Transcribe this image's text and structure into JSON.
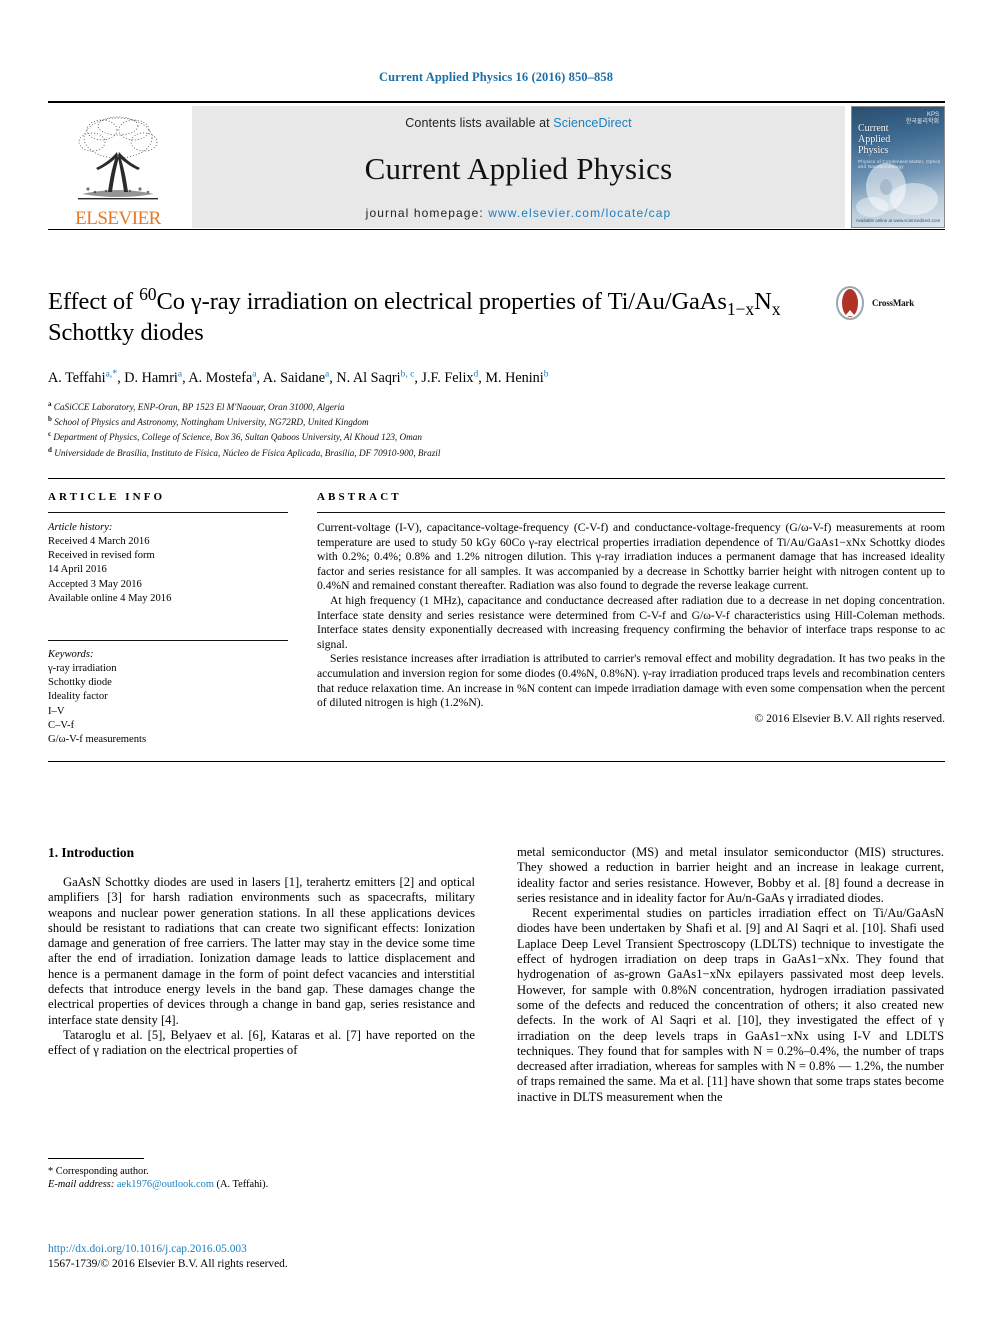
{
  "running_head": "Current Applied Physics 16 (2016) 850–858",
  "masthead": {
    "contents_prefix": "Contents lists available at",
    "sciencedirect": "ScienceDirect",
    "journal_name": "Current Applied Physics",
    "homepage_prefix": "journal homepage:",
    "homepage_url": "www.elsevier.com/locate/cap",
    "publisher": "ELSEVIER",
    "cover": {
      "line1": "Current",
      "line2": "Applied",
      "line3": "Physics",
      "kps": "KPS",
      "kps_sub": "한국물리학회",
      "subtitle": "Physics of Condensed Matter, Optics and Nanotechnology",
      "bottom": "Available online at www.sciencedirect.com"
    }
  },
  "title": {
    "part1": "Effect of ",
    "sup_60": "60",
    "part2": "Co γ-ray irradiation on electrical properties of Ti/Au/",
    "part3_pre": "GaAs",
    "sub_1x": "1−x",
    "sub_n": "N",
    "sub_nx": "x",
    "part3_post": " Schottky diodes",
    "crossmark_label": "CrossMark"
  },
  "authors": [
    {
      "name": "A. Teffahi",
      "marks": "a,",
      "star": "*",
      "sep": ", "
    },
    {
      "name": "D. Hamri",
      "marks": "a",
      "star": "",
      "sep": ", "
    },
    {
      "name": "A. Mostefa",
      "marks": "a",
      "star": "",
      "sep": ", "
    },
    {
      "name": "A. Saidane",
      "marks": "a",
      "star": "",
      "sep": ", "
    },
    {
      "name": "N. Al Saqri",
      "marks": "b, c",
      "star": "",
      "sep": ", "
    },
    {
      "name": "J.F. Felix",
      "marks": "d",
      "star": "",
      "sep": ", "
    },
    {
      "name": "M. Henini",
      "marks": "b",
      "star": "",
      "sep": ""
    }
  ],
  "affiliations": [
    {
      "mark": "a",
      "text": "CaSiCCE Laboratory, ENP-Oran, BP 1523 El M'Naouar, Oran 31000, Algeria"
    },
    {
      "mark": "b",
      "text": "School of Physics and Astronomy, Nottingham University, NG72RD, United Kingdom"
    },
    {
      "mark": "c",
      "text": "Department of Physics, College of Science, Box 36, Sultan Qaboos University, Al Khoud 123, Oman"
    },
    {
      "mark": "d",
      "text": "Universidade de Brasília, Instituto de Física, Núcleo de Física Aplicada, Brasília, DF 70910-900, Brazil"
    }
  ],
  "article_info": {
    "heading": "ARTICLE INFO",
    "history_label": "Article history:",
    "history": [
      "Received 4 March 2016",
      "Received in revised form",
      "14 April 2016",
      "Accepted 3 May 2016",
      "Available online 4 May 2016"
    ],
    "keywords_label": "Keywords:",
    "keywords": [
      "γ-ray irradiation",
      "Schottky diode",
      "Ideality factor",
      "I–V",
      "C–V-f",
      "G/ω-V-f measurements"
    ]
  },
  "abstract": {
    "heading": "ABSTRACT",
    "paragraphs": [
      "Current-voltage (I-V), capacitance-voltage-frequency (C-V-f) and conductance-voltage-frequency (G/ω-V-f) measurements at room temperature are used to study 50 kGy 60Co γ-ray electrical properties irradiation dependence of Ti/Au/GaAs1−xNx Schottky diodes with 0.2%; 0.4%; 0.8% and 1.2% nitrogen dilution. This γ-ray irradiation induces a permanent damage that has increased ideality factor and series resistance for all samples. It was accompanied by a decrease in Schottky barrier height with nitrogen content up to 0.4%N and remained constant thereafter. Radiation was also found to degrade the reverse leakage current.",
      "At high frequency (1 MHz), capacitance and conductance decreased after radiation due to a decrease in net doping concentration. Interface state density and series resistance were determined from C-V-f and G/ω-V-f characteristics using Hill-Coleman methods. Interface states density exponentially decreased with increasing frequency confirming the behavior of interface traps response to ac signal.",
      "Series resistance increases after irradiation is attributed to carrier's removal effect and mobility degradation. It has two peaks in the accumulation and inversion region for some diodes (0.4%N, 0.8%N). γ-ray irradiation produced traps levels and recombination centers that reduce relaxation time. An increase in %N content can impede irradiation damage with even some compensation when the percent of diluted nitrogen is high (1.2%N)."
    ],
    "copyright": "© 2016 Elsevier B.V. All rights reserved."
  },
  "body": {
    "section_number_title": "1. Introduction",
    "left_paragraphs": [
      "GaAsN Schottky diodes are used in lasers [1], terahertz emitters [2] and optical amplifiers [3] for harsh radiation environments such as spacecrafts, military weapons and nuclear power generation stations. In all these applications devices should be resistant to radiations that can create two significant effects: Ionization damage and generation of free carriers. The latter may stay in the device some time after the end of irradiation. Ionization damage leads to lattice displacement and hence is a permanent damage in the form of point defect vacancies and interstitial defects that introduce energy levels in the band gap. These damages change the electrical properties of devices through a change in band gap, series resistance and interface state density [4].",
      "Tataroglu et al. [5], Belyaev et al. [6], Kataras et al. [7] have reported on the effect of γ radiation on the electrical properties of"
    ],
    "right_paragraphs": [
      "metal semiconductor (MS) and metal insulator semiconductor (MIS) structures. They showed a reduction in barrier height and an increase in leakage current, ideality factor and series resistance. However, Bobby et al. [8] found a decrease in series resistance and in ideality factor for Au/n-GaAs γ irradiated diodes.",
      "Recent experimental studies on particles irradiation effect on Ti/Au/GaAsN diodes have been undertaken by Shafi et al. [9] and Al Saqri et al. [10]. Shafi used Laplace Deep Level Transient Spectroscopy (LDLTS) technique to investigate the effect of hydrogen irradiation on deep traps in GaAs1−xNx. They found that hydrogenation of as-grown GaAs1−xNx epilayers passivated most deep levels. However, for sample with 0.8%N concentration, hydrogen irradiation passivated some of the defects and reduced the concentration of others; it also created new defects. In the work of Al Saqri et al. [10], they investigated the effect of γ irradiation on the deep levels traps in GaAs1−xNx using I-V and LDLTS techniques. They found that for samples with N = 0.2%–0.4%, the number of traps decreased after irradiation, whereas for samples with N = 0.8% — 1.2%, the number of traps remained the same. Ma et al. [11] have shown that some traps states become inactive in DLTS measurement when the"
    ]
  },
  "footnote": {
    "corresponding": "* Corresponding author.",
    "email_label": "E-mail address:",
    "email": "aek1976@outlook.com",
    "email_owner": "(A. Teffahi)."
  },
  "footer": {
    "doi": "http://dx.doi.org/10.1016/j.cap.2016.05.003",
    "issn": "1567-1739/© 2016 Elsevier B.V. All rights reserved."
  },
  "colors": {
    "link": "#1a7fc1",
    "elsevier_orange": "#e87722",
    "running_head": "#1a6fa8"
  }
}
